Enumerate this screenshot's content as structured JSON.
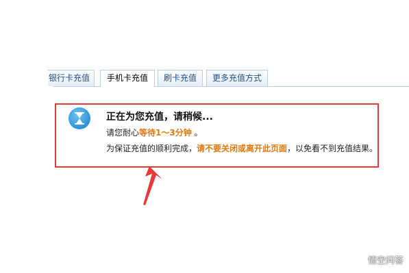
{
  "tabs": [
    {
      "label": "银行卡充值",
      "active": false
    },
    {
      "label": "手机卡充值",
      "active": true
    },
    {
      "label": "刷卡充值",
      "active": false
    },
    {
      "label": "更多充值方式",
      "active": false
    }
  ],
  "status": {
    "title": "正在为您充值，请稍候...",
    "wait_prefix": "请您耐心",
    "wait_highlight": "等待1～3分钟",
    "wait_suffix": " 。",
    "notice_prefix": "为保证充值的顺利完成，",
    "notice_highlight": "请不要关闭或离开此页面",
    "notice_suffix": "，以免看不到充值结果。"
  },
  "watermark": {
    "text": "悟空问答"
  },
  "colors": {
    "highlight": "#e07a10",
    "annotation_red": "#e63a3a",
    "icon_blue": "#2f92d6",
    "tab_border": "#b9cfe6"
  }
}
